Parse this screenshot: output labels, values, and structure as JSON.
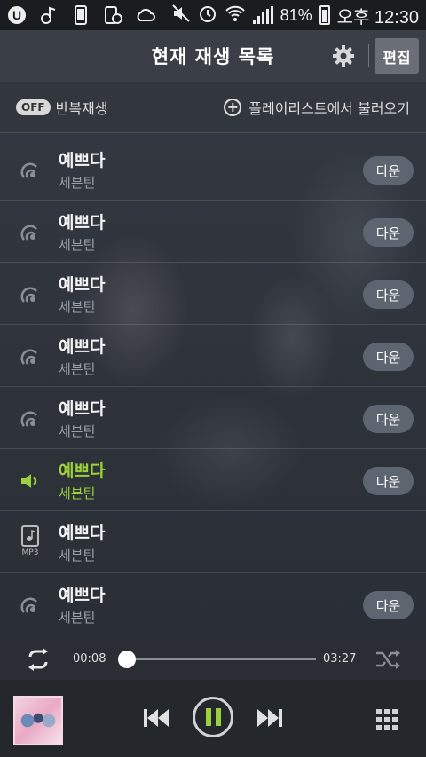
{
  "status_bar": {
    "icons": [
      "u-plus-icon",
      "music-note-icon",
      "phone-icon",
      "debug-icon",
      "cloud-icon"
    ],
    "right_icons": [
      "mute-icon",
      "alarm-icon",
      "wifi-icon",
      "signal-icon"
    ],
    "battery": "81%",
    "time": "오후 12:30"
  },
  "header": {
    "title": "현재 재생 목록",
    "edit_label": "편집"
  },
  "toolbar": {
    "repeat_badge": "OFF",
    "repeat_label": "반복재생",
    "load_playlist_label": "플레이리스트에서 불러오기"
  },
  "tracks": [
    {
      "title": "예쁘다",
      "artist": "세븐틴",
      "icon": "stream-icon",
      "down": "다운",
      "playing": false
    },
    {
      "title": "예쁘다",
      "artist": "세븐틴",
      "icon": "stream-icon",
      "down": "다운",
      "playing": false
    },
    {
      "title": "예쁘다",
      "artist": "세븐틴",
      "icon": "stream-icon",
      "down": "다운",
      "playing": false
    },
    {
      "title": "예쁘다",
      "artist": "세븐틴",
      "icon": "stream-icon",
      "down": "다운",
      "playing": false
    },
    {
      "title": "예쁘다",
      "artist": "세븐틴",
      "icon": "stream-icon",
      "down": "다운",
      "playing": false
    },
    {
      "title": "예쁘다",
      "artist": "세븐틴",
      "icon": "speaker-icon",
      "down": "다운",
      "playing": true
    },
    {
      "title": "예쁘다",
      "artist": "세븐틴",
      "icon": "mp3-icon",
      "down": "",
      "playing": false
    },
    {
      "title": "예쁘다",
      "artist": "세븐틴",
      "icon": "stream-icon",
      "down": "다운",
      "playing": false
    }
  ],
  "progress": {
    "current": "00:08",
    "total": "03:27",
    "fraction": 0.039
  },
  "colors": {
    "accent": "#9bd23c",
    "background": "#2c3038"
  }
}
